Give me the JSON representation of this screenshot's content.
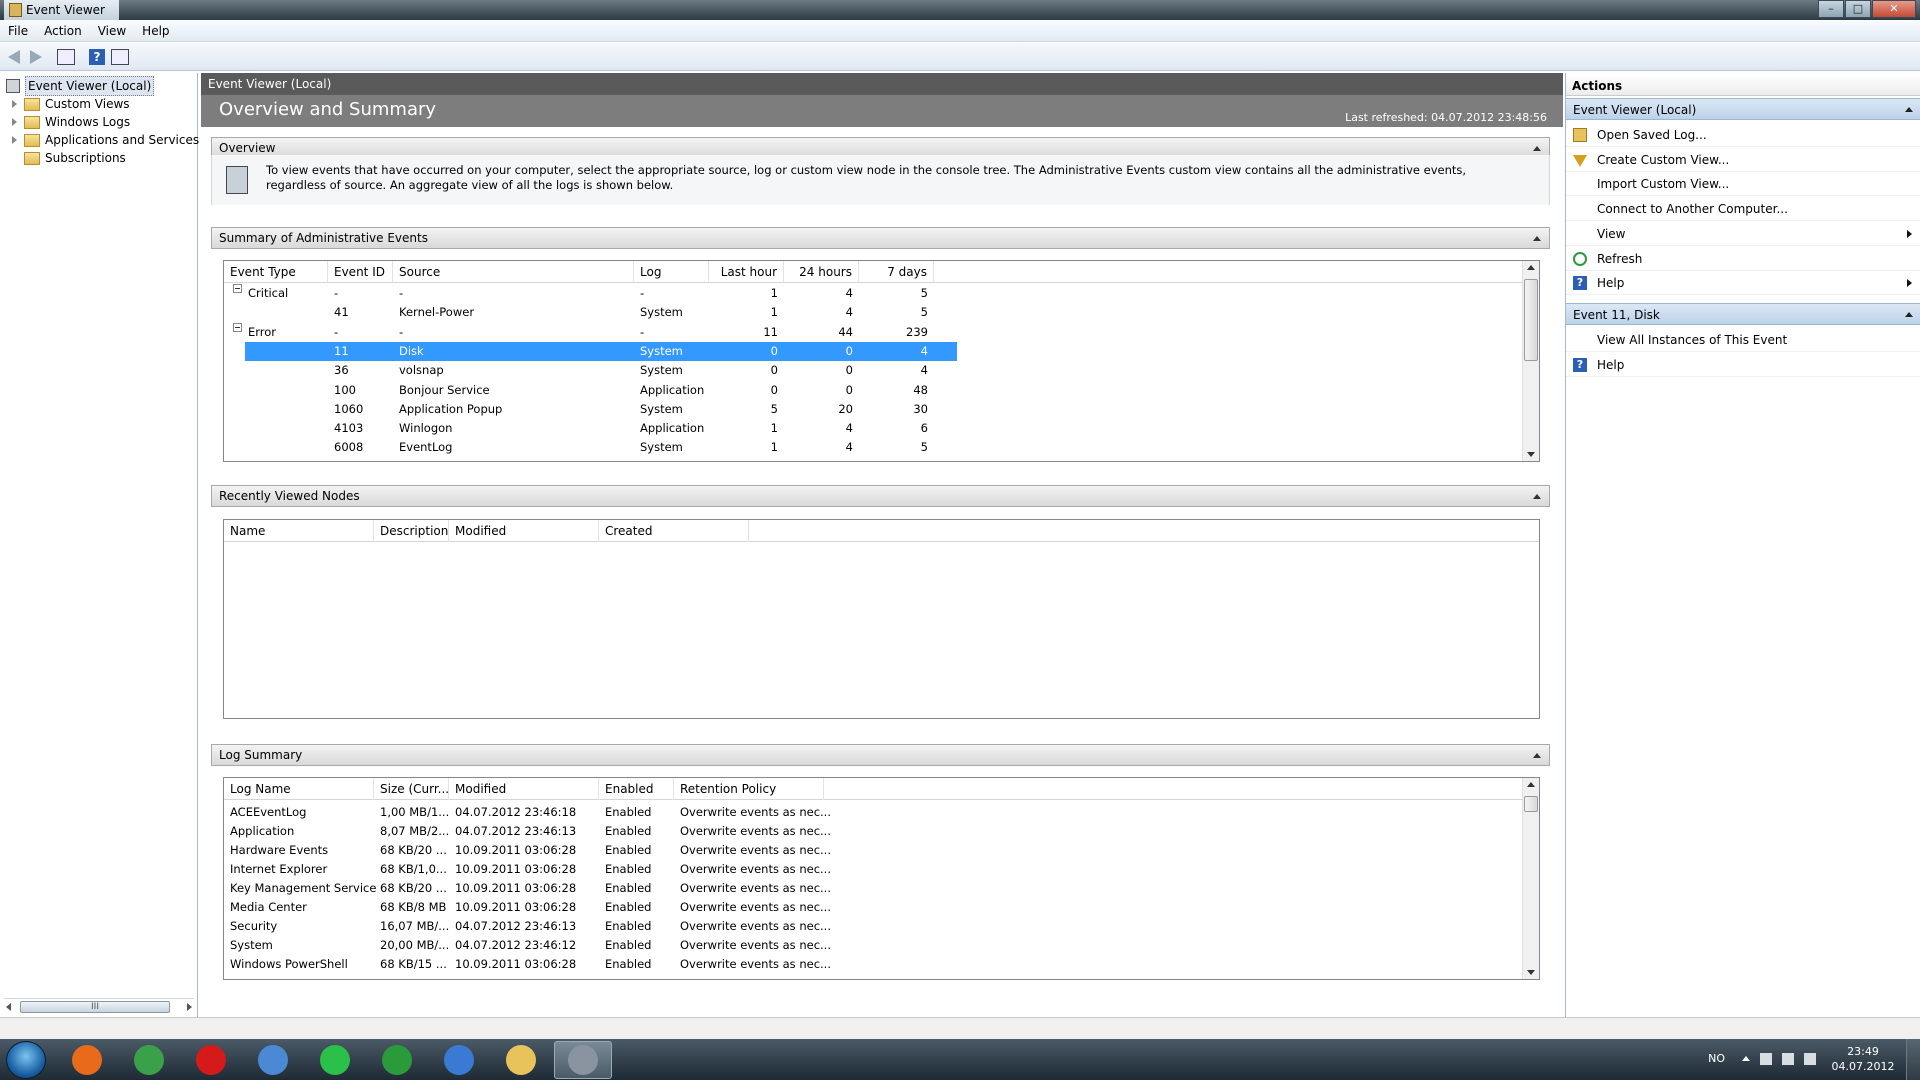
{
  "window": {
    "title": "Event Viewer",
    "minimize": "–",
    "maximize": "□",
    "close": "✕"
  },
  "menu": [
    "File",
    "Action",
    "View",
    "Help"
  ],
  "tree": {
    "items": [
      {
        "label": "Event Viewer (Local)"
      },
      {
        "label": "Custom Views"
      },
      {
        "label": "Windows Logs"
      },
      {
        "label": "Applications and Services Lo"
      },
      {
        "label": "Subscriptions"
      }
    ],
    "scroll_grip": "III"
  },
  "center": {
    "header": "Event Viewer (Local)",
    "title": "Overview and Summary",
    "last_refreshed": "Last refreshed: 04.07.2012 23:48:56",
    "overview": {
      "heading": "Overview",
      "text": "To view events that have occurred on your computer, select the appropriate source, log or custom view node in the console tree. The Administrative Events custom view contains all the administrative events, regardless of source. An aggregate view of all the logs is shown below."
    },
    "summary": {
      "heading": "Summary of Administrative Events",
      "columns": [
        "Event Type",
        "Event ID",
        "Source",
        "Log",
        "Last hour",
        "24 hours",
        "7 days"
      ],
      "rows": [
        {
          "type": "Critical",
          "id": "-",
          "source": "-",
          "log": "-",
          "hour": "1",
          "day": "4",
          "week": "5",
          "group": true
        },
        {
          "type": "",
          "id": "41",
          "source": "Kernel-Power",
          "log": "System",
          "hour": "1",
          "day": "4",
          "week": "5"
        },
        {
          "type": "Error",
          "id": "-",
          "source": "-",
          "log": "-",
          "hour": "11",
          "day": "44",
          "week": "239",
          "group": true
        },
        {
          "type": "",
          "id": "11",
          "source": "Disk",
          "log": "System",
          "hour": "0",
          "day": "0",
          "week": "4",
          "selected": true
        },
        {
          "type": "",
          "id": "36",
          "source": "volsnap",
          "log": "System",
          "hour": "0",
          "day": "0",
          "week": "4"
        },
        {
          "type": "",
          "id": "100",
          "source": "Bonjour Service",
          "log": "Application",
          "hour": "0",
          "day": "0",
          "week": "48"
        },
        {
          "type": "",
          "id": "1060",
          "source": "Application Popup",
          "log": "System",
          "hour": "5",
          "day": "20",
          "week": "30"
        },
        {
          "type": "",
          "id": "4103",
          "source": "Winlogon",
          "log": "Application",
          "hour": "1",
          "day": "4",
          "week": "6"
        },
        {
          "type": "",
          "id": "6008",
          "source": "EventLog",
          "log": "System",
          "hour": "1",
          "day": "4",
          "week": "5"
        }
      ]
    },
    "recent": {
      "heading": "Recently Viewed Nodes",
      "columns": [
        "Name",
        "Description",
        "Modified",
        "Created"
      ]
    },
    "log_summary": {
      "heading": "Log Summary",
      "columns": [
        "Log Name",
        "Size (Curr...",
        "Modified",
        "Enabled",
        "Retention Policy"
      ],
      "rows": [
        {
          "name": "ACEEventLog",
          "size": "1,00 MB/1...",
          "modified": "04.07.2012 23:46:18",
          "enabled": "Enabled",
          "policy": "Overwrite events as nec..."
        },
        {
          "name": "Application",
          "size": "8,07 MB/2...",
          "modified": "04.07.2012 23:46:13",
          "enabled": "Enabled",
          "policy": "Overwrite events as nec..."
        },
        {
          "name": "Hardware Events",
          "size": "68 KB/20 ...",
          "modified": "10.09.2011 03:06:28",
          "enabled": "Enabled",
          "policy": "Overwrite events as nec..."
        },
        {
          "name": "Internet Explorer",
          "size": "68 KB/1,0...",
          "modified": "10.09.2011 03:06:28",
          "enabled": "Enabled",
          "policy": "Overwrite events as nec..."
        },
        {
          "name": "Key Management Service",
          "size": "68 KB/20 ...",
          "modified": "10.09.2011 03:06:28",
          "enabled": "Enabled",
          "policy": "Overwrite events as nec..."
        },
        {
          "name": "Media Center",
          "size": "68 KB/8 MB",
          "modified": "10.09.2011 03:06:28",
          "enabled": "Enabled",
          "policy": "Overwrite events as nec..."
        },
        {
          "name": "Security",
          "size": "16,07 MB/...",
          "modified": "04.07.2012 23:46:13",
          "enabled": "Enabled",
          "policy": "Overwrite events as nec..."
        },
        {
          "name": "System",
          "size": "20,00 MB/...",
          "modified": "04.07.2012 23:46:12",
          "enabled": "Enabled",
          "policy": "Overwrite events as nec..."
        },
        {
          "name": "Windows PowerShell",
          "size": "68 KB/15 ...",
          "modified": "10.09.2011 03:06:28",
          "enabled": "Enabled",
          "policy": "Overwrite events as nec..."
        }
      ]
    }
  },
  "actions": {
    "title": "Actions",
    "groups": [
      {
        "label": "Event Viewer (Local)",
        "items": [
          {
            "label": "Open Saved Log...",
            "icon": "open-folder-icon"
          },
          {
            "label": "Create Custom View...",
            "icon": "filter-icon"
          },
          {
            "label": "Import Custom View...",
            "icon": ""
          },
          {
            "label": "Connect to Another Computer...",
            "icon": ""
          },
          {
            "label": "View",
            "icon": "",
            "submenu": true
          },
          {
            "label": "Refresh",
            "icon": "refresh-icon"
          },
          {
            "label": "Help",
            "icon": "help-icon",
            "submenu": true
          }
        ]
      },
      {
        "label": "Event 11, Disk",
        "items": [
          {
            "label": "View All Instances of This Event",
            "icon": ""
          },
          {
            "label": "Help",
            "icon": "help-icon"
          }
        ]
      }
    ]
  },
  "taskbar": {
    "apps": [
      "firefox-icon",
      "chrome-icon",
      "opera-icon",
      "control-panel-icon",
      "spotify-icon",
      "utorrent-icon",
      "itunes-icon",
      "explorer-icon",
      "event-viewer-icon"
    ],
    "language": "NO",
    "time": "23:49",
    "date": "04.07.2012"
  },
  "colors": {
    "selection": "#3399ff",
    "header_dark": "#5a5a5a",
    "banner": "#7d7d7d"
  }
}
